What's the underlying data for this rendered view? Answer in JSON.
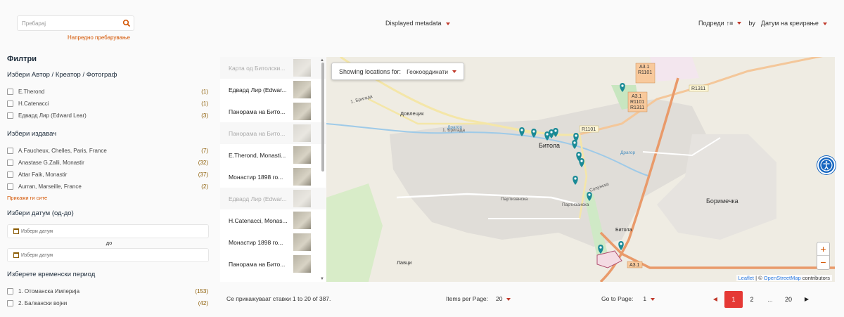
{
  "search": {
    "placeholder": "Пребарај",
    "advanced_link": "Напредно пребарување"
  },
  "metadata_dropdown": {
    "label": "Displayed metadata"
  },
  "sort": {
    "label": "Подреди",
    "by": "by",
    "field": "Датум на креирање"
  },
  "filters": {
    "title": "Филтри",
    "author": {
      "title": "Избери Автор / Креатор / Фотограф",
      "items": [
        {
          "label": "E.Therond",
          "count": "(1)"
        },
        {
          "label": "H.Catenacci",
          "count": "(1)"
        },
        {
          "label": "Едвард Лир (Edward Lear)",
          "count": "(3)"
        }
      ]
    },
    "publisher": {
      "title": "Избери издавач",
      "items": [
        {
          "label": "A.Faucheux, Chelles, Paris, France",
          "count": "(7)"
        },
        {
          "label": "Anastase G.Zalli, Monastir",
          "count": "(32)"
        },
        {
          "label": "Attar Faik, Monastir",
          "count": "(37)"
        },
        {
          "label": "Aurran, Marseille, France",
          "count": "(2)"
        }
      ],
      "show_all": "Прикажи ги сите"
    },
    "date": {
      "title": "Избери датум (од-до)",
      "from_placeholder": "Избери датум",
      "to_word": "до",
      "to_placeholder": "Избери датум"
    },
    "period": {
      "title": "Изберете временски период",
      "items": [
        {
          "label": "1. Отоманска Империја",
          "count": "(153)"
        },
        {
          "label": "2. Балкански војни",
          "count": "(42)"
        }
      ]
    }
  },
  "results_list": [
    {
      "title": "Карта од Битолски...",
      "faded": true
    },
    {
      "title": "Едвард Лир (Edwar...",
      "faded": false
    },
    {
      "title": "Панорама на Бито...",
      "faded": false
    },
    {
      "title": "Панорама на Бито...",
      "faded": true
    },
    {
      "title": "E.Therond, Monasti...",
      "faded": false
    },
    {
      "title": "Монастир 1898 го...",
      "faded": false
    },
    {
      "title": "Едвард Лир (Edwar...",
      "faded": true
    },
    {
      "title": "H.Catenacci, Monas...",
      "faded": false
    },
    {
      "title": "Монастир 1898 го...",
      "faded": false
    },
    {
      "title": "Панорама на Бито...",
      "faded": false
    }
  ],
  "map": {
    "locations_label": "Showing locations for:",
    "locations_value": "Геокоординати",
    "zoom_in": "+",
    "zoom_out": "−",
    "attribution_leaflet": "Leaflet",
    "attribution_sep": " | © ",
    "attribution_osm": "OpenStreetMap",
    "attribution_tail": " contributors",
    "labels": {
      "city": "Битола",
      "city2": "Битола",
      "borimechka": "Боримечка",
      "dovlecik": "Довлецик",
      "lavci": "Лавци",
      "brigada1": "1. Бригада",
      "brigada2": "1. Бригада",
      "dragor1": "Драгор",
      "dragor2": "Драгор",
      "partizanska": "Партизанска",
      "partizanska2": "Партизанска",
      "solunska": "Солунска",
      "r1101": "R1101",
      "r1311": "R1311",
      "a3_top": "A3.1",
      "r1101_top": "R1101",
      "a3_mid": "A3.1",
      "r1101_mid": "R1101",
      "r1311_mid": "R1311",
      "a3_bottom": "A3.1"
    },
    "marker_color": "#1a8a96"
  },
  "bottom": {
    "summary": "Се прикажуваат ставки 1 to 20 of 387.",
    "items_per_page_label": "Items per Page:",
    "items_per_page_value": "20",
    "goto_label": "Go to Page:",
    "goto_value": "1",
    "pages": [
      "1",
      "2",
      "...",
      "20"
    ],
    "active_page": "1"
  },
  "colors": {
    "accent": "#d35400",
    "active_page": "#e53935",
    "a11y": "#1565c0"
  }
}
